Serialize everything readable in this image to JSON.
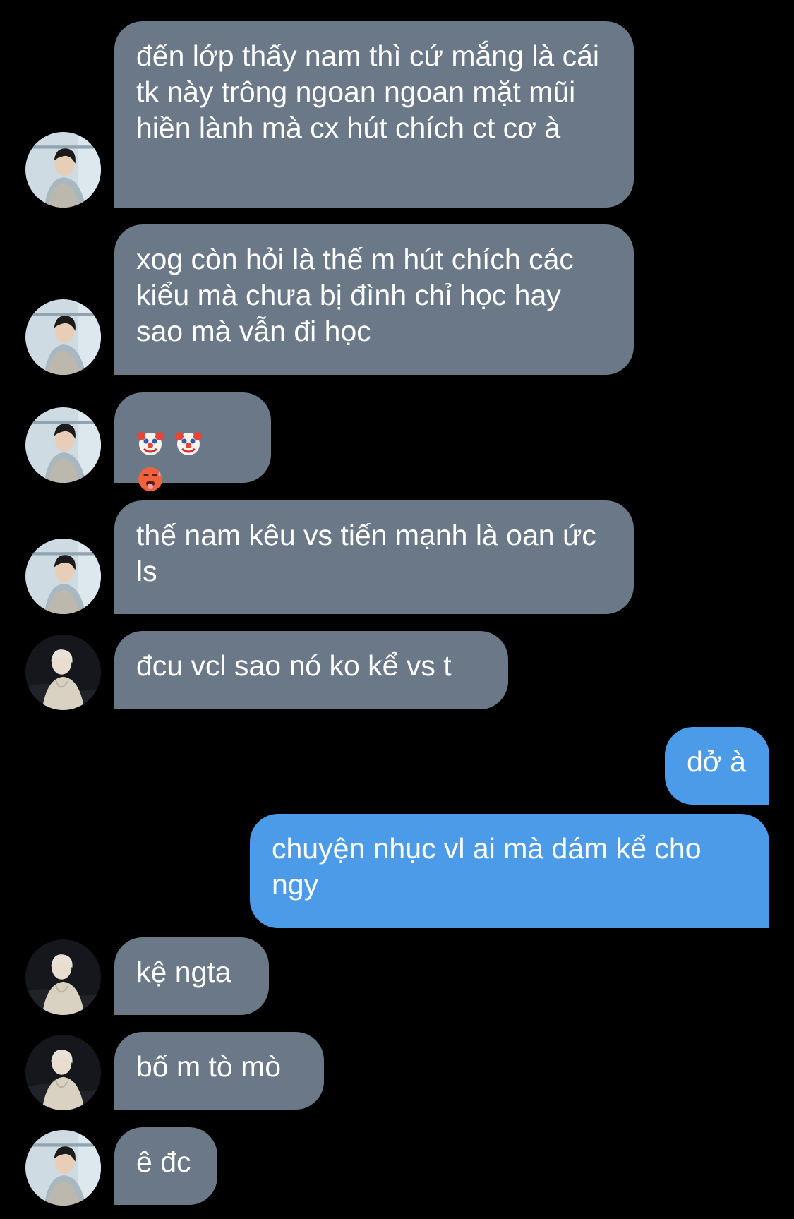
{
  "colors": {
    "background": "#000000",
    "incoming_bubble": "#6a7887",
    "outgoing_bubble": "#4c9be8",
    "bubble_text": "#ffffff"
  },
  "messages": [
    {
      "sender": "contact-a",
      "text": "đến lớp thấy nam thì cứ mắng là cái tk này trông ngoan ngoan mặt mũi hiền lành mà cx hút chích ct cơ à"
    },
    {
      "sender": "contact-a",
      "text": "xog còn hỏi là thế m hút chích các kiểu mà chưa bị đình chỉ học hay sao mà vẫn đi học"
    },
    {
      "sender": "contact-a",
      "emojis": [
        "clown-face-emoji",
        "clown-face-emoji",
        "hot-face-emoji"
      ]
    },
    {
      "sender": "contact-a",
      "text": "thế nam kêu vs tiến mạnh là oan ức ls"
    },
    {
      "sender": "contact-b",
      "text": "đcu vcl sao nó ko kể vs t"
    },
    {
      "sender": "me",
      "text": "dở à"
    },
    {
      "sender": "me",
      "text": "chuyện nhục vl ai mà dám kể cho ngy"
    },
    {
      "sender": "contact-b",
      "text": "kệ ngta"
    },
    {
      "sender": "contact-b",
      "text": "bố m tò mò"
    },
    {
      "sender": "contact-a",
      "text": "ê đc"
    }
  ]
}
